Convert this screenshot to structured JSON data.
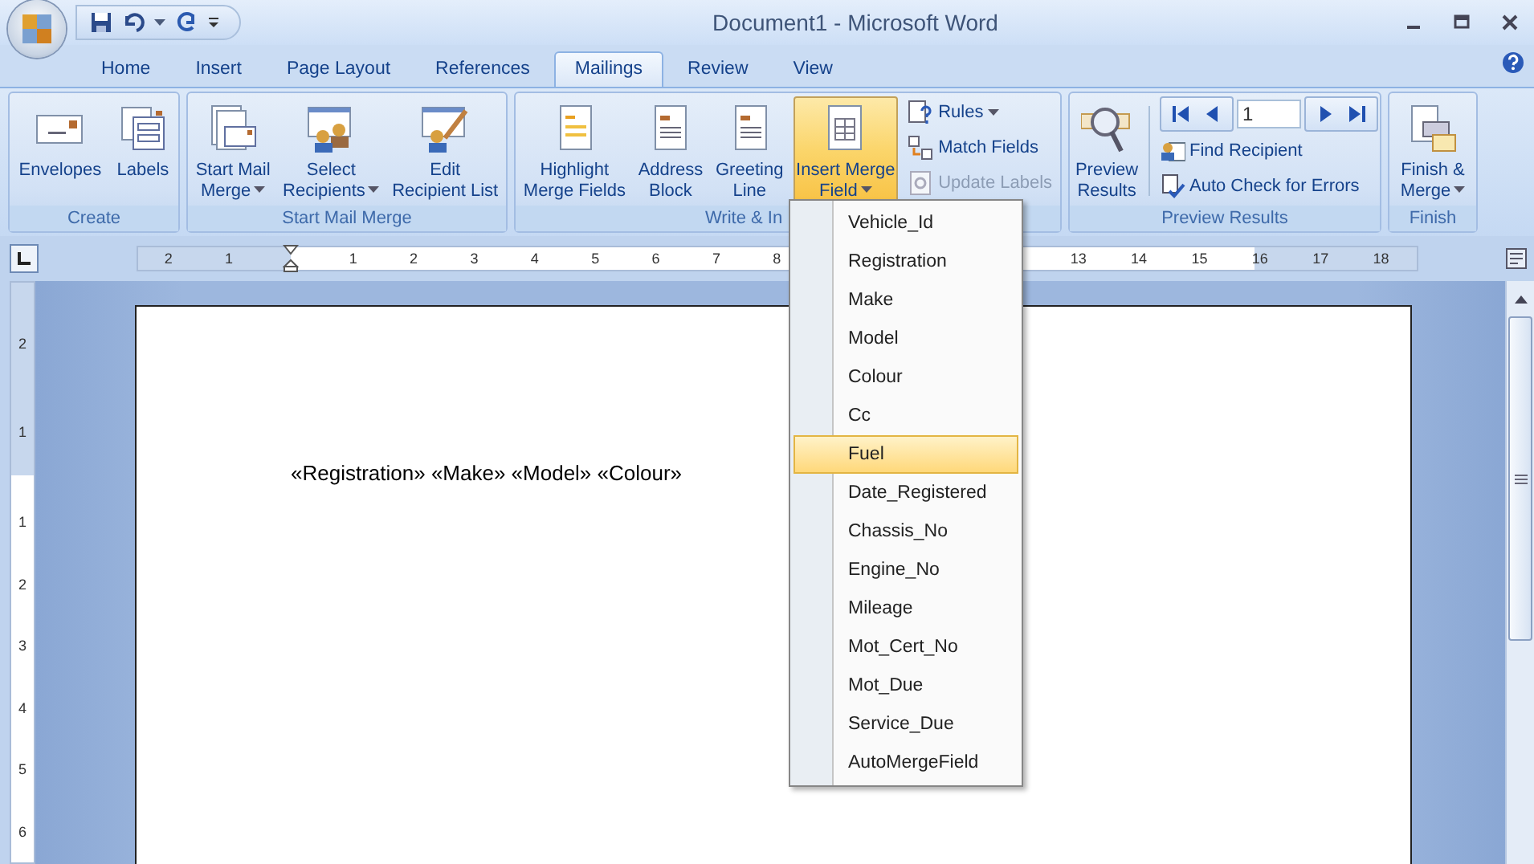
{
  "window": {
    "title": "Document1 - Microsoft Word"
  },
  "tabs": [
    {
      "label": "Home",
      "selected": false
    },
    {
      "label": "Insert",
      "selected": false
    },
    {
      "label": "Page Layout",
      "selected": false
    },
    {
      "label": "References",
      "selected": false
    },
    {
      "label": "Mailings",
      "selected": true
    },
    {
      "label": "Review",
      "selected": false
    },
    {
      "label": "View",
      "selected": false
    }
  ],
  "ribbon": {
    "groups": [
      {
        "label": "Create",
        "buttons": [
          {
            "lines": [
              "Envelopes"
            ],
            "dropdown": false,
            "active": false
          },
          {
            "lines": [
              "Labels"
            ],
            "dropdown": false,
            "active": false
          }
        ]
      },
      {
        "label": "Start Mail Merge",
        "buttons": [
          {
            "lines": [
              "Start Mail",
              "Merge"
            ],
            "dropdown": true,
            "active": false
          },
          {
            "lines": [
              "Select",
              "Recipients"
            ],
            "dropdown": true,
            "active": false
          },
          {
            "lines": [
              "Edit",
              "Recipient List"
            ],
            "dropdown": false,
            "active": false
          }
        ]
      },
      {
        "label": "Write & In",
        "buttons": [
          {
            "lines": [
              "Highlight",
              "Merge Fields"
            ],
            "dropdown": false,
            "active": false
          },
          {
            "lines": [
              "Address",
              "Block"
            ],
            "dropdown": false,
            "active": false
          },
          {
            "lines": [
              "Greeting",
              "Line"
            ],
            "dropdown": false,
            "active": false
          },
          {
            "lines": [
              "Insert Merge",
              "Field"
            ],
            "dropdown": true,
            "active": true
          }
        ],
        "small": [
          {
            "label": "Rules",
            "dropdown": true,
            "disabled": false
          },
          {
            "label": "Match Fields",
            "dropdown": false,
            "disabled": false
          },
          {
            "label": "Update Labels",
            "dropdown": false,
            "disabled": true
          }
        ]
      },
      {
        "label": "Preview Results",
        "buttons": [
          {
            "lines": [
              "Preview",
              "Results"
            ],
            "dropdown": false,
            "active": false
          }
        ],
        "record": "1",
        "small": [
          {
            "label": "Find Recipient",
            "dropdown": false,
            "disabled": false
          },
          {
            "label": "Auto Check for Errors",
            "dropdown": false,
            "disabled": false
          }
        ]
      },
      {
        "label": "Finish",
        "buttons": [
          {
            "lines": [
              "Finish &",
              "Merge"
            ],
            "dropdown": true,
            "active": false
          }
        ]
      }
    ]
  },
  "ruler": {
    "left_labels": [
      "2",
      "1"
    ],
    "right_labels": [
      "1",
      "2",
      "3",
      "4",
      "5",
      "6",
      "7",
      "8"
    ],
    "far_labels": [
      "13",
      "14",
      "15",
      "16",
      "17",
      "18"
    ]
  },
  "vertical_ruler": {
    "top_labels": [
      "2",
      "1"
    ],
    "labels": [
      "1",
      "2",
      "3",
      "4",
      "5",
      "6"
    ]
  },
  "document": {
    "text": "«Registration» «Make» «Model» «Colour»"
  },
  "merge_field_menu": {
    "items": [
      {
        "label": "Vehicle_Id",
        "selected": false
      },
      {
        "label": "Registration",
        "selected": false
      },
      {
        "label": "Make",
        "selected": false
      },
      {
        "label": "Model",
        "selected": false
      },
      {
        "label": "Colour",
        "selected": false
      },
      {
        "label": "Cc",
        "selected": false
      },
      {
        "label": "Fuel",
        "selected": true
      },
      {
        "label": "Date_Registered",
        "selected": false
      },
      {
        "label": "Chassis_No",
        "selected": false
      },
      {
        "label": "Engine_No",
        "selected": false
      },
      {
        "label": "Mileage",
        "selected": false
      },
      {
        "label": "Mot_Cert_No",
        "selected": false
      },
      {
        "label": "Mot_Due",
        "selected": false
      },
      {
        "label": "Service_Due",
        "selected": false
      },
      {
        "label": "AutoMergeField",
        "selected": false
      }
    ]
  }
}
